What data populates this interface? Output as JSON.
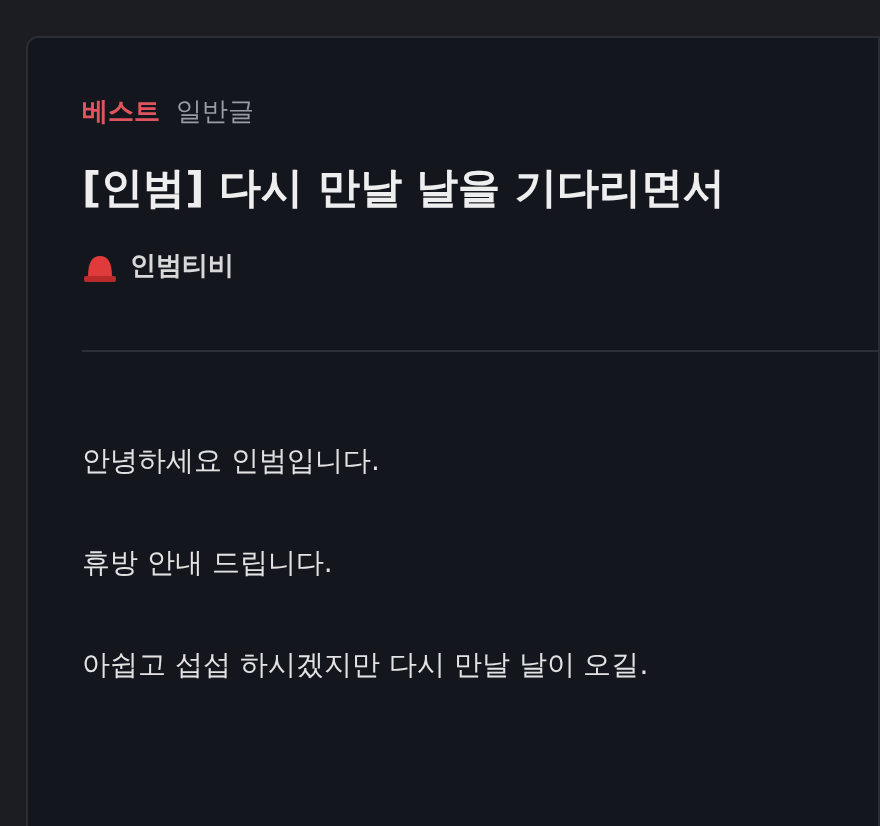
{
  "post": {
    "badge": "베스트",
    "category": "일반글",
    "title": "[인범] 다시 만날 날을 기다리면서",
    "author": "인범티비",
    "paragraphs": [
      "안녕하세요 인범입니다.",
      "휴방 안내 드립니다.",
      "아쉽고 섭섭 하시겠지만 다시 만날 날이 오길."
    ]
  }
}
